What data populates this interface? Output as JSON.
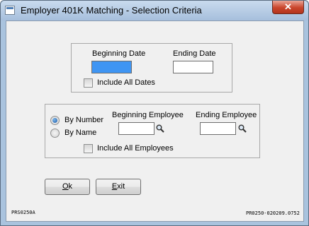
{
  "window": {
    "title": "Employer 401K Matching - Selection Criteria",
    "close_glyph": "✕"
  },
  "date_section": {
    "beginning_date_label": "Beginning Date",
    "ending_date_label": "Ending Date",
    "beginning_date_value": "",
    "ending_date_value": "",
    "include_all_dates_label": "Include All Dates",
    "include_all_dates_checked": false
  },
  "employee_section": {
    "by_number_label": "By Number",
    "by_name_label": "By Name",
    "selected_sort": "By Number",
    "beginning_employee_label": "Beginning Employee",
    "ending_employee_label": "Ending Employee",
    "beginning_employee_value": "",
    "ending_employee_value": "",
    "include_all_employees_label": "Include All Employees",
    "include_all_employees_checked": false,
    "lookup_icon": "magnifier-icon"
  },
  "buttons": {
    "ok_accel": "O",
    "ok_rest": "k",
    "exit_accel": "E",
    "exit_rest": "xit"
  },
  "footer": {
    "program_code": "PRS0250A",
    "version_code": "PR0250-020209.0752"
  },
  "colors": {
    "focused_field": "#3f95f3",
    "frame": "#a9c3de",
    "client_bg": "#f0f0f0"
  }
}
